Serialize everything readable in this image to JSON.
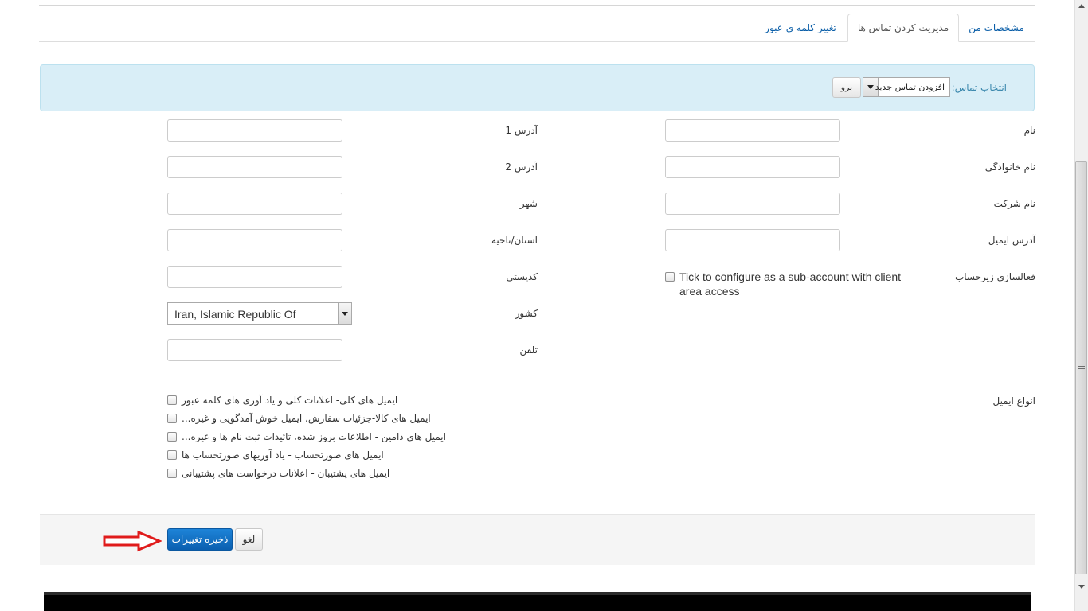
{
  "tabs": [
    {
      "label": "مشخصات من",
      "active": false
    },
    {
      "label": "مدیریت کردن تماس ها",
      "active": true
    },
    {
      "label": "تغییر کلمه ی عبور",
      "active": false
    }
  ],
  "contact_selector": {
    "label": "انتخاب تماس:",
    "selected": "افزودن تماس جدید",
    "go_label": "برو"
  },
  "form_right": {
    "first_name_label": "نام",
    "last_name_label": "نام خانوادگی",
    "company_label": "نام شرکت",
    "email_label": "آدرس ایمیل",
    "subaccount_label": "فعالسازی زیرحساب",
    "subaccount_text": "Tick to configure as a sub-account with client area access"
  },
  "form_left": {
    "address1_label": "آدرس 1",
    "address2_label": "آدرس 2",
    "city_label": "شهر",
    "state_label": "استان/ناحیه",
    "postcode_label": "کدپستی",
    "country_label": "کشور",
    "country_value": "Iran, Islamic Republic Of",
    "phone_label": "تلفن"
  },
  "email_types": {
    "label": "انواع ایمیل",
    "options": [
      "ایمیل های کلی- اعلانات کلی و یاد آوری های کلمه عبور",
      "ایمیل های کالا-جزئیات سفارش، ایمیل خوش آمدگویی و غیره...",
      "ایمیل های دامین - اطلاعات بروز شده، تائیدات ثبت نام ها و غیره...",
      "ایمیل های صورتحساب - یاد آوریهای صورتحساب ها",
      "ایمیل های پشتیبان - اعلانات درخواست های پشتیبانی"
    ]
  },
  "actions": {
    "save_label": "ذخیره تغییرات",
    "cancel_label": "لغو"
  },
  "colors": {
    "link": "#0a5ea8",
    "info_bg": "#d9eef7",
    "primary_button": "#1e84d8",
    "annotation_arrow": "#e01b1b"
  },
  "icons": {
    "annotation": "red-arrow-icon",
    "scroll_grip": "grip-icon"
  }
}
